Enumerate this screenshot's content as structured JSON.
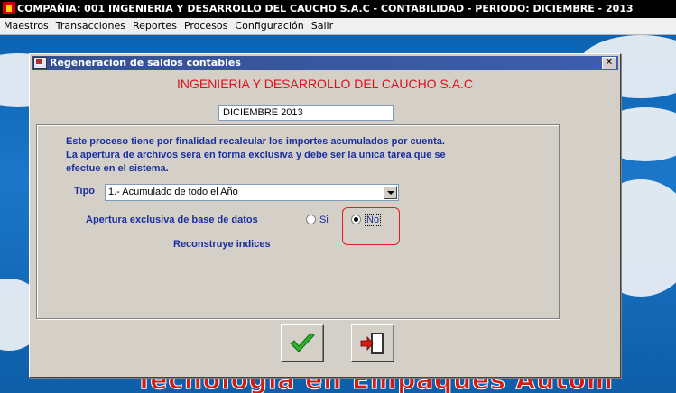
{
  "app": {
    "title": "COMPAÑIA: 001 INGENIERIA Y DESARROLLO DEL CAUCHO S.A.C   -   CONTABILIDAD   -   PERIODO: DICIEMBRE - 2013"
  },
  "menu": {
    "items": [
      "Maestros",
      "Transacciones",
      "Reportes",
      "Procesos",
      "Configuración",
      "Salir"
    ]
  },
  "background": {
    "banner": "Tecnologia en Empaques Autom"
  },
  "dialog": {
    "title": "Regeneracion de saldos contables",
    "close_label": "✕",
    "company": "INGENIERIA Y DESARROLLO DEL CAUCHO S.A.C",
    "period": "DICIEMBRE 2013",
    "description": [
      "Este proceso tiene por finalidad recalcular los importes acumulados por cuenta.",
      "La apertura de archivos sera en forma exclusiva y debe ser la unica tarea que se",
      "efectue en el sistema."
    ],
    "tipo_label": "Tipo",
    "tipo_value": "1.- Acumulado de todo el Año",
    "apertura_label": "Apertura exclusiva de base de datos",
    "radio_si": "Si",
    "radio_no": "No",
    "apertura_selected": "No",
    "reconstruye_label": "Reconstruye indices",
    "ok_icon": "checkmark-icon",
    "exit_icon": "exit-door-icon"
  },
  "colors": {
    "company_red": "#e0101b",
    "label_blue": "#1a2f9e",
    "dialog_gray": "#d4d0c8",
    "title_bar": "#3a56a0"
  }
}
